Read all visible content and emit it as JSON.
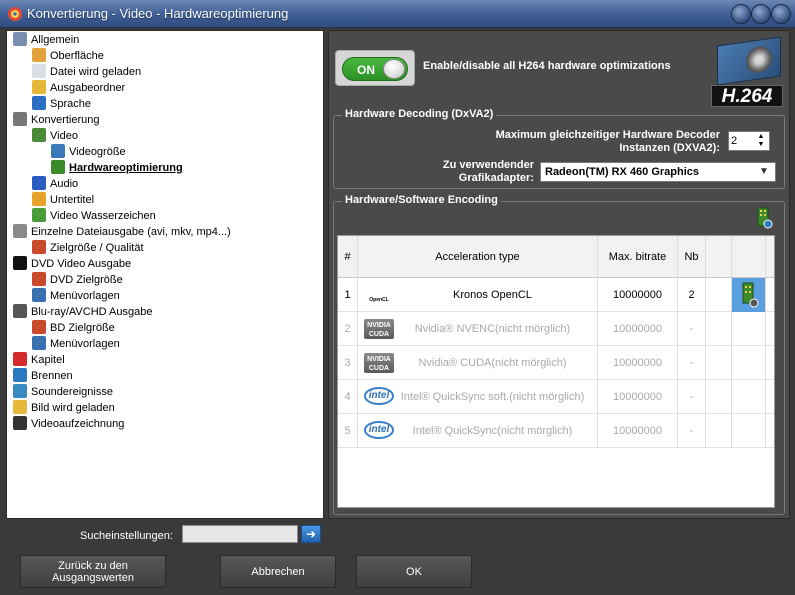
{
  "window": {
    "title": "Konvertierung - Video - Hardwareoptimierung"
  },
  "tree": {
    "items": [
      {
        "label": "Allgemein",
        "icon": "wrench-icon",
        "color": "#7a8fb0"
      },
      {
        "label": "Oberfläche",
        "icon": "palette-icon",
        "color": "#e2a23a"
      },
      {
        "label": "Datei wird geladen",
        "icon": "document-icon",
        "color": "#d8dde6"
      },
      {
        "label": "Ausgabeordner",
        "icon": "folder-icon",
        "color": "#e4b93a"
      },
      {
        "label": "Sprache",
        "icon": "globe-icon",
        "color": "#2a6fc2"
      },
      {
        "label": "Konvertierung",
        "icon": "gear-icon",
        "color": "#777777"
      },
      {
        "label": "Video",
        "icon": "video-icon",
        "color": "#4a8b3a"
      },
      {
        "label": "Videogröße",
        "icon": "video-size-icon",
        "color": "#3a7ab8"
      },
      {
        "label": "Hardwareoptimierung",
        "icon": "chip-icon",
        "color": "#3d8a2a"
      },
      {
        "label": "Audio",
        "icon": "music-note-icon",
        "color": "#2a5cc2"
      },
      {
        "label": "Untertitel",
        "icon": "subtitle-icon",
        "color": "#e8a42a"
      },
      {
        "label": "Video Wasserzeichen",
        "icon": "watermark-icon",
        "color": "#4a9b3a"
      },
      {
        "label": "Einzelne Dateiausgabe (avi, mkv, mp4...)",
        "icon": "file-output-icon",
        "color": "#8a8a8a"
      },
      {
        "label": "Zielgröße / Qualität",
        "icon": "target-icon",
        "color": "#c84a2a"
      },
      {
        "label": "DVD Video Ausgabe",
        "icon": "dvd-icon",
        "color": "#111111"
      },
      {
        "label": "DVD Zielgröße",
        "icon": "target-icon",
        "color": "#c84a2a"
      },
      {
        "label": "Menüvorlagen",
        "icon": "menu-template-icon",
        "color": "#3a6fb0"
      },
      {
        "label": "Blu-ray/AVCHD Ausgabe",
        "icon": "hd-icon",
        "color": "#555555"
      },
      {
        "label": "BD Zielgröße",
        "icon": "target-icon",
        "color": "#c84a2a"
      },
      {
        "label": "Menüvorlagen",
        "icon": "menu-template-icon",
        "color": "#3a6fb0"
      },
      {
        "label": "Kapitel",
        "icon": "flag-icon",
        "color": "#d42a2a"
      },
      {
        "label": "Brennen",
        "icon": "burn-disc-icon",
        "color": "#2a7ac2"
      },
      {
        "label": "Soundereignisse",
        "icon": "sound-icon",
        "color": "#3a8ac2"
      },
      {
        "label": "Bild wird geladen",
        "icon": "image-icon",
        "color": "#e4b93a"
      },
      {
        "label": "Videoaufzeichnung",
        "icon": "camera-icon",
        "color": "#333333"
      }
    ]
  },
  "toggle": {
    "label": "ON",
    "description": "Enable/disable all H264 hardware optimizations"
  },
  "badge": {
    "text": "H.264"
  },
  "decoding": {
    "title": "Hardware Decoding (DxVA2)",
    "instances_label": "Maximum gleichzeitiger Hardware Decoder Instanzen (DXVA2):",
    "instances_value": "2",
    "adapter_label": "Zu verwendender Grafikadapter:",
    "adapter_value": "Radeon(TM) RX 460 Graphics"
  },
  "encoding": {
    "title": "Hardware/Software Encoding",
    "columns": [
      "#",
      "Acceleration type",
      "Max. bitrate",
      "Nb"
    ],
    "rows": [
      {
        "num": "1",
        "logo": "kronos",
        "logo_text": "OpenCL",
        "type": "Kronos OpenCL",
        "bitrate": "10000000",
        "nb": "2",
        "enabled": true
      },
      {
        "num": "2",
        "logo": "nvidia",
        "logo_text": "NVIDIA CUDA",
        "type": "Nvidia® NVENC(nicht mörglich)",
        "bitrate": "10000000",
        "nb": "-",
        "enabled": false
      },
      {
        "num": "3",
        "logo": "nvidia",
        "logo_text": "NVIDIA CUDA",
        "type": "Nvidia® CUDA(nicht mörglich)",
        "bitrate": "10000000",
        "nb": "-",
        "enabled": false
      },
      {
        "num": "4",
        "logo": "intel",
        "logo_text": "intel",
        "type": "Intel® QuickSync soft.(nicht mörglich)",
        "bitrate": "10000000",
        "nb": "-",
        "enabled": false
      },
      {
        "num": "5",
        "logo": "intel",
        "logo_text": "intel",
        "type": "Intel® QuickSync(nicht mörglich)",
        "bitrate": "10000000",
        "nb": "-",
        "enabled": false
      }
    ]
  },
  "search": {
    "label": "Sucheinstellungen:",
    "value": "",
    "placeholder": ""
  },
  "buttons": {
    "reset": "Zurück zu den Ausgangswerten",
    "cancel": "Abbrechen",
    "ok": "OK"
  }
}
